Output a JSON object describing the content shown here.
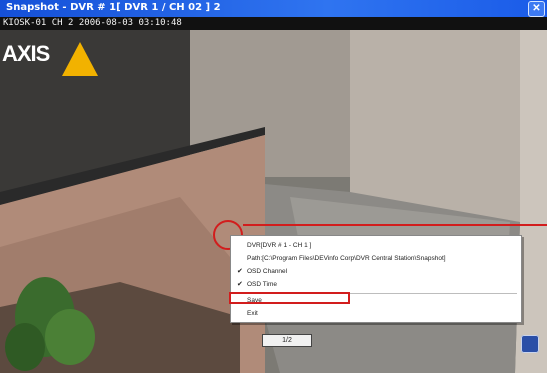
{
  "window": {
    "title": "Snapshot - DVR # 1[ DVR 1 / CH 02 ] 2"
  },
  "overlay": {
    "timestamp": "KIOSK-01 CH 2 2006-08-03 03:10:48",
    "logo_text": "AXIS"
  },
  "context_menu": {
    "items": [
      {
        "label": "DVR[DVR # 1 - CH 1 ]",
        "checked": false
      },
      {
        "label": "Path:[C:\\Program Files\\DEVinfo Corp\\DVR Central Station\\Snapshot]",
        "checked": false
      },
      {
        "label": "OSD Channel",
        "checked": true
      },
      {
        "label": "OSD Time",
        "checked": true
      },
      {
        "label": "Save",
        "checked": false,
        "highlighted": true
      },
      {
        "label": "Exit",
        "checked": false
      }
    ]
  },
  "status": {
    "page": "1/2"
  },
  "colors": {
    "title_bar": "#2f74f0",
    "annotation": "#d21d1d",
    "logo_triangle": "#f2b200"
  }
}
